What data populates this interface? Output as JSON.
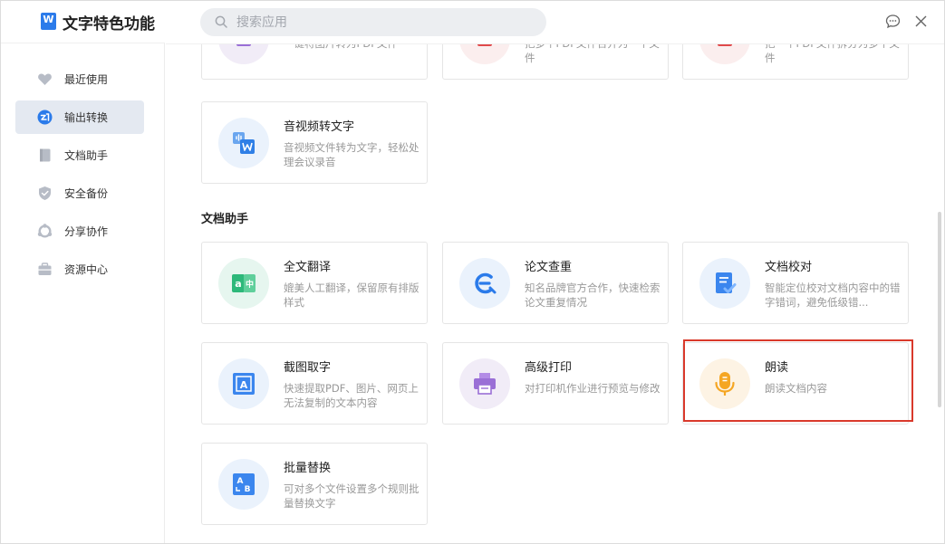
{
  "app": {
    "logo_letter": "W",
    "title": "文字特色功能"
  },
  "search": {
    "placeholder": "搜索应用",
    "value": ""
  },
  "sidebar": {
    "items": [
      {
        "label": "最近使用",
        "icon": "heart-icon",
        "active": false
      },
      {
        "label": "输出转换",
        "icon": "convert-icon",
        "active": true
      },
      {
        "label": "文档助手",
        "icon": "document-icon",
        "active": false
      },
      {
        "label": "安全备份",
        "icon": "shield-icon",
        "active": false
      },
      {
        "label": "分享协作",
        "icon": "share-icon",
        "active": false
      },
      {
        "label": "资源中心",
        "icon": "briefcase-icon",
        "active": false
      }
    ]
  },
  "partial_cards": [
    {
      "title": "",
      "desc": "一键将图片转为PDF文件"
    },
    {
      "title": "",
      "desc": "把多个PDF文件合并为一个文件"
    },
    {
      "title": "",
      "desc": "把一个PDF文件拆分为多个文件"
    }
  ],
  "convert_cards": [
    {
      "title": "音视频转文字",
      "desc": "音视频文件转为文字，轻松处理会议录音",
      "icon": "audio-to-word-icon"
    }
  ],
  "section": {
    "title": "文档助手"
  },
  "assistant_cards": [
    {
      "title": "全文翻译",
      "desc": "媲美人工翻译，保留原有排版样式",
      "icon": "translate-icon"
    },
    {
      "title": "论文查重",
      "desc": "知名品牌官方合作，快速检索论文重复情况",
      "icon": "plagiarism-check-icon"
    },
    {
      "title": "文档校对",
      "desc": "智能定位校对文档内容中的错字错词，避免低级错...",
      "icon": "proofread-icon"
    },
    {
      "title": "截图取字",
      "desc": "快速提取PDF、图片、网页上无法复制的文本内容",
      "icon": "screenshot-ocr-icon"
    },
    {
      "title": "高级打印",
      "desc": "对打印机作业进行预览与修改",
      "icon": "printer-icon"
    },
    {
      "title": "朗读",
      "desc": "朗读文档内容",
      "icon": "microphone-icon",
      "highlighted": true
    },
    {
      "title": "批量替换",
      "desc": "可对多个文件设置多个规则批量替换文字",
      "icon": "batch-replace-icon"
    }
  ],
  "colors": {
    "accent": "#2b7bea",
    "highlight_border": "#d9392b",
    "active_nav_bg": "#e4e9f1"
  }
}
